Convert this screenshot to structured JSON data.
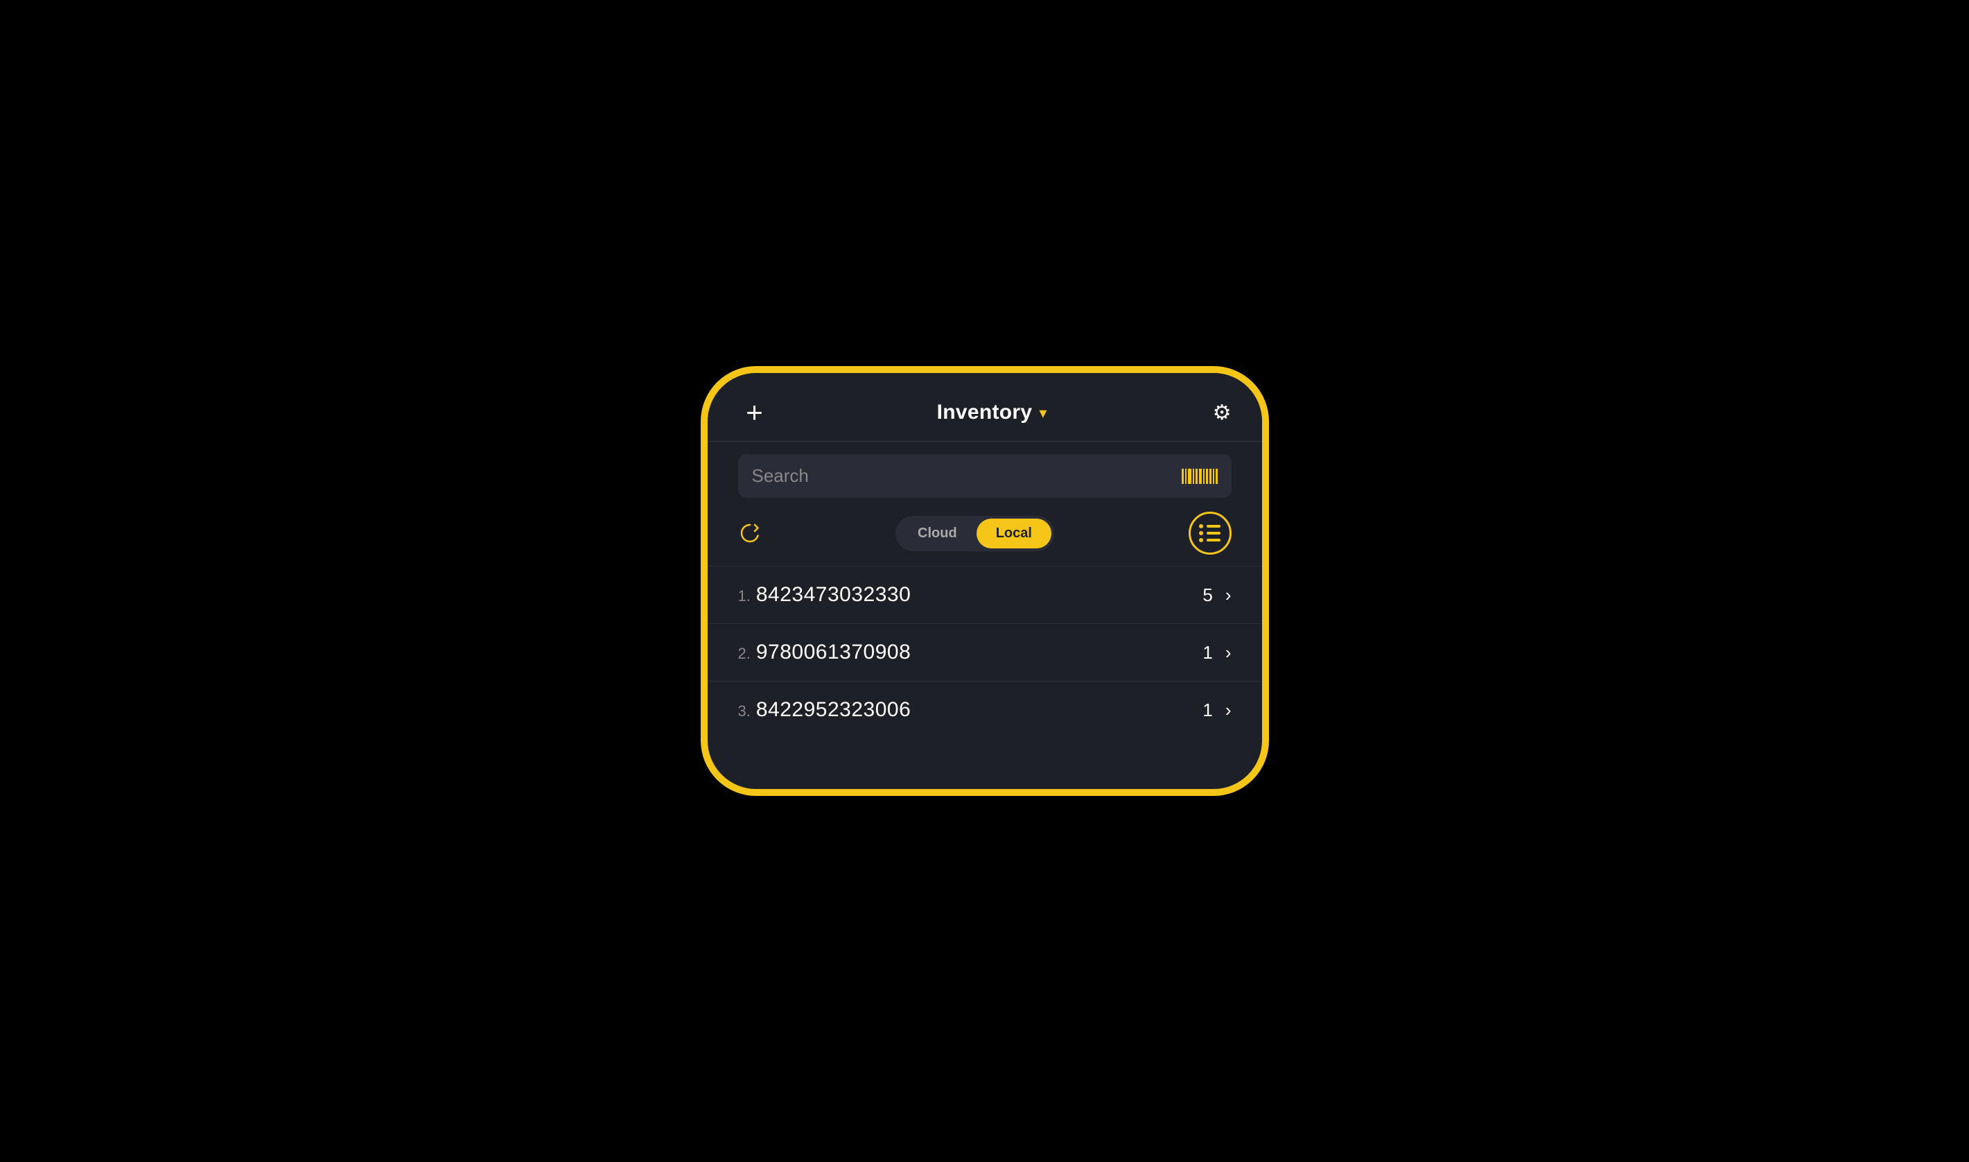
{
  "page": {
    "background": "#000"
  },
  "header": {
    "add_label": "+",
    "title": "Inventory",
    "chevron": "▾",
    "settings_icon": "⚙"
  },
  "search": {
    "placeholder": "Search"
  },
  "filters": {
    "cloud_label": "Cloud",
    "local_label": "Local",
    "active": "local"
  },
  "items": [
    {
      "index": "1.",
      "code": "8423473032330",
      "qty": "5"
    },
    {
      "index": "2.",
      "code": "9780061370908",
      "qty": "1"
    },
    {
      "index": "3.",
      "code": "8422952323006",
      "qty": "1"
    }
  ]
}
